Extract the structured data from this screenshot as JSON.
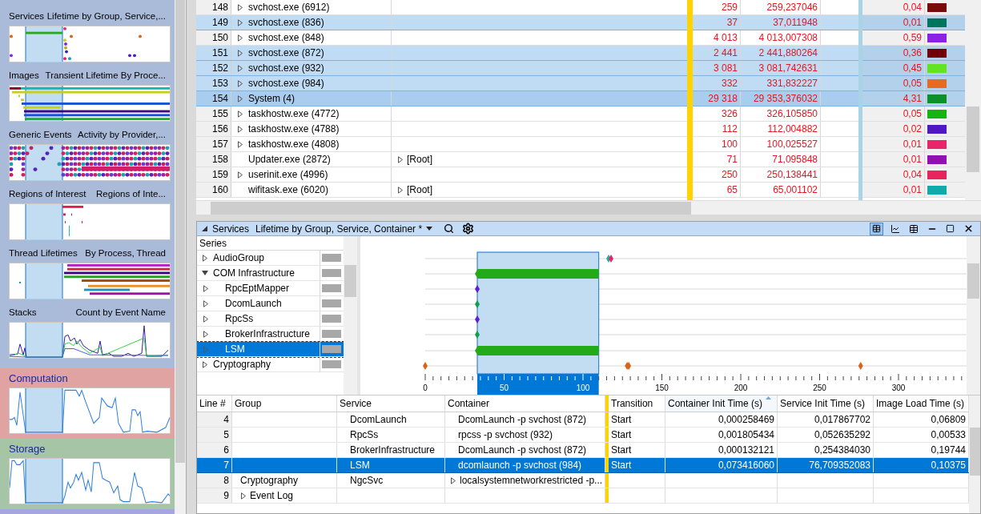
{
  "sidebar": {
    "groups": [
      {
        "color": "#a9bbd9",
        "graphs": [
          {
            "title": "Services",
            "subtitle": "Lifetime by Group, Service,...",
            "kind": "markers"
          },
          {
            "title": "Images",
            "subtitle": "Transient Lifetime By Proce...",
            "kind": "bars"
          },
          {
            "title": "Generic Events",
            "subtitle": "Activity by Provider,...",
            "kind": "events"
          },
          {
            "title": "Regions of Interest",
            "subtitle": "Regions of Inte...",
            "kind": "regions"
          },
          {
            "title": "Thread Lifetimes",
            "subtitle": "By Process, Thread",
            "kind": "threads"
          },
          {
            "title": "Stacks",
            "subtitle": "Count by Event Name",
            "kind": "lines"
          }
        ]
      },
      {
        "title": "Computation",
        "color": "#e1a2a2",
        "graphs": [
          {
            "kind": "line"
          }
        ]
      },
      {
        "title": "Storage",
        "color": "#a6c4a6",
        "graphs": [
          {
            "kind": "line2"
          }
        ]
      },
      {
        "color": "#a5a5e0"
      }
    ]
  },
  "process_table": {
    "rows": [
      {
        "line": "148",
        "process": "svchost.exe (6912)",
        "expandable": true,
        "count": "259",
        "weight": "259,237046",
        "percent": "0,04",
        "color": "#7a0a0a",
        "selected": false,
        "focused": false
      },
      {
        "line": "149",
        "process": "svchost.exe (836)",
        "expandable": true,
        "count": "37",
        "weight": "37,011948",
        "percent": "0,01",
        "color": "#00755e",
        "selected": true,
        "focused": false
      },
      {
        "line": "150",
        "process": "svchost.exe (848)",
        "expandable": true,
        "count": "4 013",
        "weight": "4 013,007308",
        "percent": "0,59",
        "color": "#8a22e6",
        "selected": false,
        "focused": false
      },
      {
        "line": "151",
        "process": "svchost.exe (872)",
        "expandable": true,
        "count": "2 441",
        "weight": "2 441,880264",
        "percent": "0,36",
        "color": "#720008",
        "selected": true,
        "focused": false
      },
      {
        "line": "152",
        "process": "svchost.exe (932)",
        "expandable": true,
        "count": "3 081",
        "weight": "3 081,742631",
        "percent": "0,45",
        "color": "#62e422",
        "selected": true,
        "focused": false
      },
      {
        "line": "153",
        "process": "svchost.exe (984)",
        "expandable": true,
        "count": "332",
        "weight": "331,832227",
        "percent": "0,05",
        "color": "#e86a22",
        "selected": true,
        "focused": false
      },
      {
        "line": "154",
        "process": "System (4)",
        "expandable": true,
        "count": "29 318",
        "weight": "29 353,376032",
        "percent": "4,31",
        "color": "#0a912a",
        "selected": true,
        "focused": true
      },
      {
        "line": "155",
        "process": "taskhostw.exe (4772)",
        "expandable": true,
        "count": "326",
        "weight": "326,105850",
        "percent": "0,05",
        "color": "#14b414",
        "selected": false,
        "focused": false
      },
      {
        "line": "156",
        "process": "taskhostw.exe (4788)",
        "expandable": true,
        "count": "112",
        "weight": "112,004882",
        "percent": "0,02",
        "color": "#5018c0",
        "selected": false,
        "focused": false
      },
      {
        "line": "157",
        "process": "taskhostw.exe (4808)",
        "expandable": true,
        "count": "100",
        "weight": "100,025527",
        "percent": "0,01",
        "color": "#e8246a",
        "selected": false,
        "focused": false
      },
      {
        "line": "158",
        "process": "Updater.exe (2872)",
        "expandable": false,
        "stack": "[Root]",
        "count": "71",
        "weight": "71,095848",
        "percent": "0,01",
        "color": "#9010b0",
        "selected": false,
        "focused": false
      },
      {
        "line": "159",
        "process": "userinit.exe (4996)",
        "expandable": true,
        "count": "250",
        "weight": "250,138441",
        "percent": "0,04",
        "color": "#e8245e",
        "selected": false,
        "focused": false
      },
      {
        "line": "160",
        "process": "wifitask.exe (6020)",
        "expandable": false,
        "stack": "[Root]",
        "count": "65",
        "weight": "65,001102",
        "percent": "0,01",
        "color": "#10aaaa",
        "selected": false,
        "focused": false
      }
    ]
  },
  "panel": {
    "title": "Services",
    "view": "Lifetime by Group, Service, Container *"
  },
  "series": {
    "heading": "Series",
    "items": [
      {
        "name": "AudioGroup",
        "expanded": false,
        "selected": false
      },
      {
        "name": "COM Infrastructure",
        "expanded": true,
        "selected": false,
        "children": [
          {
            "name": "RpcEptMapper",
            "expanded": false,
            "selected": false
          },
          {
            "name": "DcomLaunch",
            "expanded": false,
            "selected": false
          },
          {
            "name": "RpcSs",
            "expanded": false,
            "selected": false
          },
          {
            "name": "BrokerInfrastructure",
            "expanded": false,
            "selected": false
          },
          {
            "name": "LSM",
            "expanded": false,
            "selected": true
          }
        ]
      },
      {
        "name": "Cryptography",
        "expanded": false,
        "selected": false
      }
    ]
  },
  "timeline": {
    "axis_ticks": [
      "0",
      "50",
      "100",
      "150",
      "200",
      "250",
      "300"
    ]
  },
  "services_table": {
    "columns": [
      "Line #",
      "Group",
      "Service",
      "Container",
      "Transition",
      "Container Init Time (s)",
      "Service Init Time (s)",
      "Image Load Time (s)"
    ],
    "rows": [
      {
        "line": "4",
        "service": "DcomLaunch",
        "container": "DcomLaunch -p svchost (872)",
        "transition": "Start",
        "container_init": "0,000258469",
        "service_init": "0,017867702",
        "image_load": "0,06809",
        "selected": false
      },
      {
        "line": "5",
        "service": "RpcSs",
        "container": "rpcss -p svchost (932)",
        "transition": "Start",
        "container_init": "0,001805434",
        "service_init": "0,052635292",
        "image_load": "0,00533",
        "selected": false
      },
      {
        "line": "6",
        "service": "BrokerInfrastructure",
        "container": "DcomLaunch -p svchost (872)",
        "transition": "Start",
        "container_init": "0,000132121",
        "service_init": "0,254384030",
        "image_load": "0,19744",
        "selected": false
      },
      {
        "line": "7",
        "service": "LSM",
        "container": "dcomlaunch -p svchost (984)",
        "transition": "Start",
        "container_init": "0,073416060",
        "service_init": "76,709352083",
        "image_load": "0,10375",
        "selected": true
      },
      {
        "line": "8",
        "group": "Cryptography",
        "service": "NgcSvc",
        "container": "localsystemnetworkrestricted -p...",
        "container_expandable": true,
        "selected": false
      },
      {
        "line": "9",
        "group": "Event Log",
        "group_expandable": true,
        "selected": false
      }
    ]
  }
}
